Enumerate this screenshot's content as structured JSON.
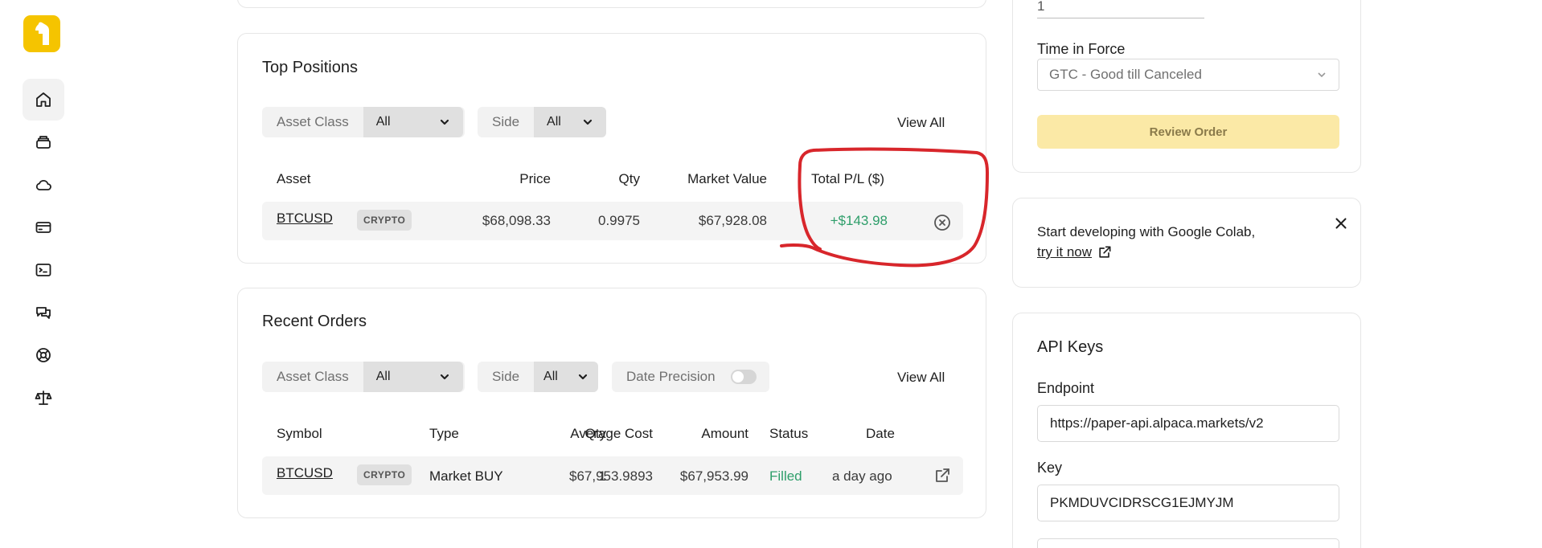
{
  "sidebar": {
    "logo_icon": "alpaca-logo",
    "items": [
      {
        "icon": "home-icon",
        "active": true
      },
      {
        "icon": "archive-icon",
        "active": false
      },
      {
        "icon": "cloud-icon",
        "active": false
      },
      {
        "icon": "credit-card-icon",
        "active": false
      },
      {
        "icon": "terminal-icon",
        "active": false
      },
      {
        "icon": "chat-icon",
        "active": false
      },
      {
        "icon": "support-icon",
        "active": false
      },
      {
        "icon": "scale-icon",
        "active": false
      }
    ]
  },
  "positions": {
    "title": "Top Positions",
    "filters": {
      "asset_class_label": "Asset Class",
      "asset_class_value": "All",
      "side_label": "Side",
      "side_value": "All"
    },
    "view_all": "View All",
    "headers": {
      "asset": "Asset",
      "price": "Price",
      "qty": "Qty",
      "market_value": "Market Value",
      "total_pl": "Total P/L ($)"
    },
    "rows": [
      {
        "asset": "BTCUSD",
        "badge": "CRYPTO",
        "price": "$68,098.33",
        "qty": "0.9975",
        "market_value": "$67,928.08",
        "total_pl": "+$143.98"
      }
    ]
  },
  "orders": {
    "title": "Recent Orders",
    "filters": {
      "asset_class_label": "Asset Class",
      "asset_class_value": "All",
      "side_label": "Side",
      "side_value": "All",
      "date_precision_label": "Date Precision"
    },
    "view_all": "View All",
    "headers": {
      "symbol": "Symbol",
      "type": "Type",
      "qty": "Qty",
      "avg_cost": "Average Cost",
      "amount": "Amount",
      "status": "Status",
      "date": "Date"
    },
    "rows": [
      {
        "symbol": "BTCUSD",
        "badge": "CRYPTO",
        "type": "Market BUY",
        "qty": "1",
        "avg_cost": "$67,953.9893",
        "amount": "$67,953.99",
        "status": "Filled",
        "date": "a day ago"
      }
    ]
  },
  "order_form": {
    "qty_value": "1",
    "time_in_force_label": "Time in Force",
    "time_in_force_value": "GTC - Good till Canceled",
    "review_button": "Review Order"
  },
  "colab_banner": {
    "text": "Start developing with Google Colab,",
    "link": "try it now"
  },
  "api_keys": {
    "title": "API Keys",
    "endpoint_label": "Endpoint",
    "endpoint_value": "https://paper-api.alpaca.markets/v2",
    "key_label": "Key",
    "key_value": "PKMDUVCIDRSCG1EJMYJM"
  },
  "colors": {
    "accent": "#f5c400",
    "positive": "#2e9e6a",
    "annotation": "#d8262b",
    "review_button_bg": "#fbe9a6"
  }
}
